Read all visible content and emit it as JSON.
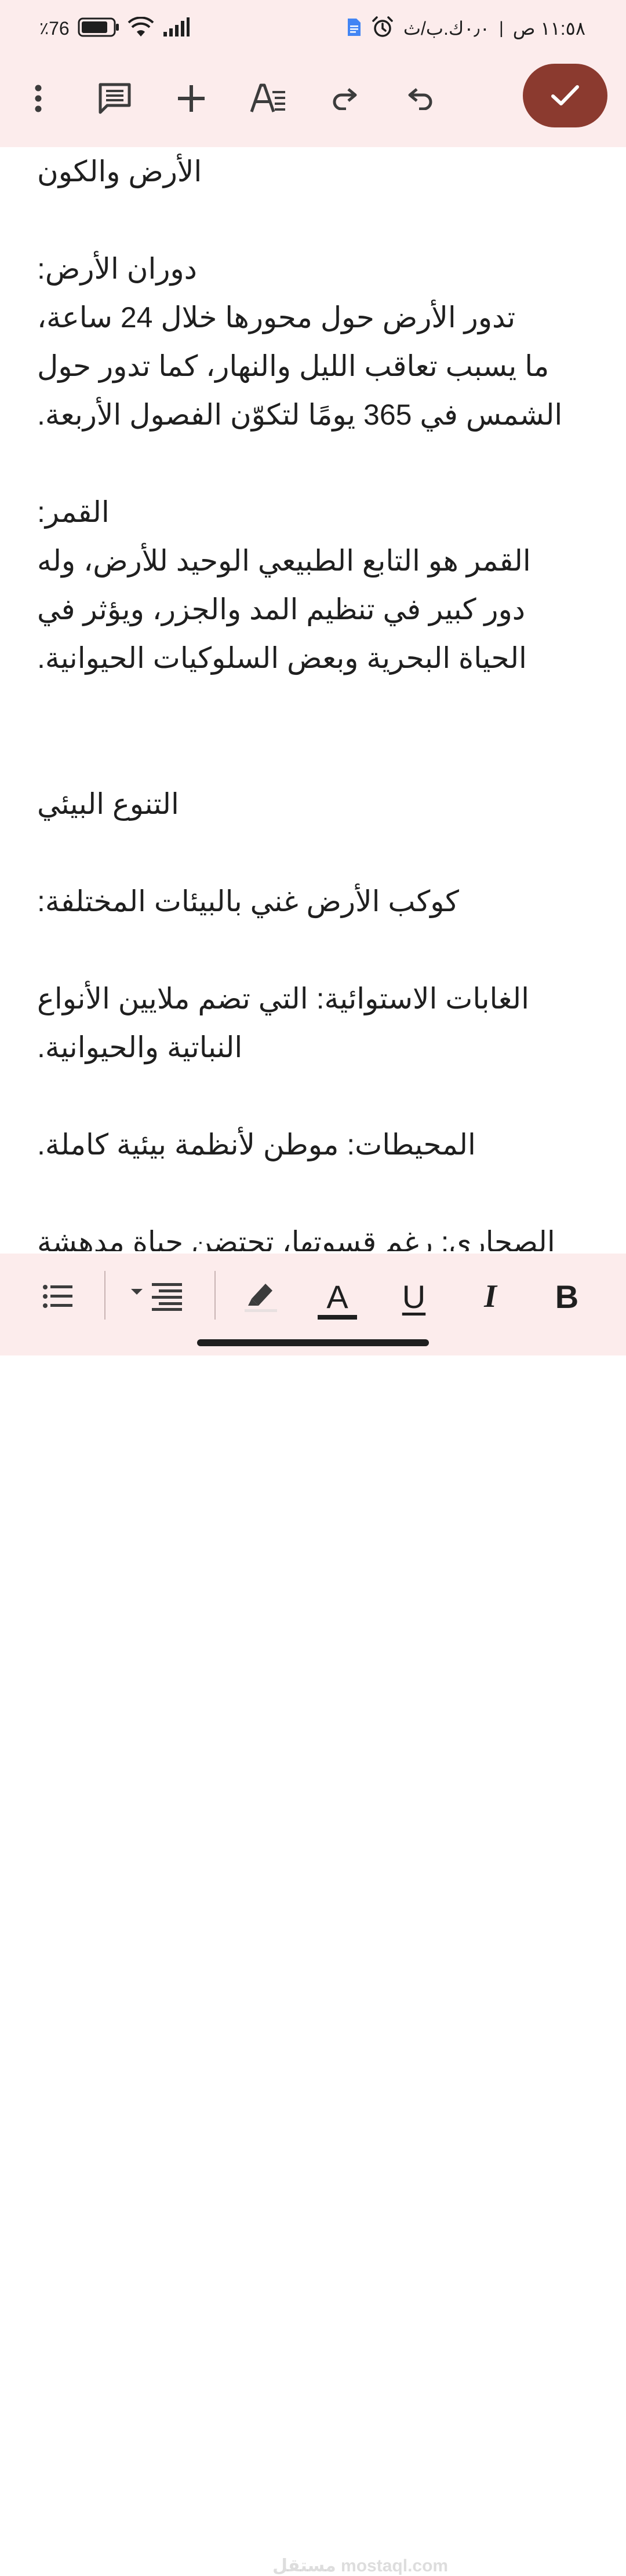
{
  "status_bar": {
    "battery_text": "76",
    "battery_percent_sign": "٪",
    "time_text": "١١:٥٨ ص",
    "speed_text": "٠٫٠ك.ب/ث",
    "separator": "|"
  },
  "toolbar": {
    "icons": [
      "more-vert-icon",
      "comment-icon",
      "insert-icon",
      "text-format-icon",
      "redo-icon",
      "undo-icon",
      "check-icon"
    ]
  },
  "document": {
    "lines": [
      "الأرض والكون",
      "",
      "دوران الأرض:",
      "تدور الأرض حول محورها خلال 24 ساعة،",
      "ما يسبب تعاقب الليل والنهار، كما تدور حول",
      "الشمس في 365 يومًا لتكوّن الفصول الأربعة.",
      "",
      "القمر:",
      "القمر هو التابع الطبيعي الوحيد للأرض، وله",
      "دور كبير في تنظيم المد والجزر، ويؤثر في",
      "الحياة البحرية وبعض السلوكيات الحيوانية.",
      "",
      "",
      "التنوع البيئي",
      "",
      "كوكب الأرض غني بالبيئات المختلفة:",
      "",
      "الغابات الاستوائية: التي تضم ملايين الأنواع",
      "النباتية والحيوانية.",
      "",
      "المحيطات: موطن لأنظمة بيئية كاملة.",
      "",
      "الصحاري: رغم قسوتها، تحتضن حياة مدهشة"
    ]
  },
  "format_bar": {
    "bold_label": "B",
    "italic_label": "I",
    "underline_label": "U",
    "text_color_label": "A",
    "watermark": "مستقل mostaql.com"
  },
  "colors": {
    "bar_background": "#fcecec",
    "accent": "#8b3a2f"
  }
}
